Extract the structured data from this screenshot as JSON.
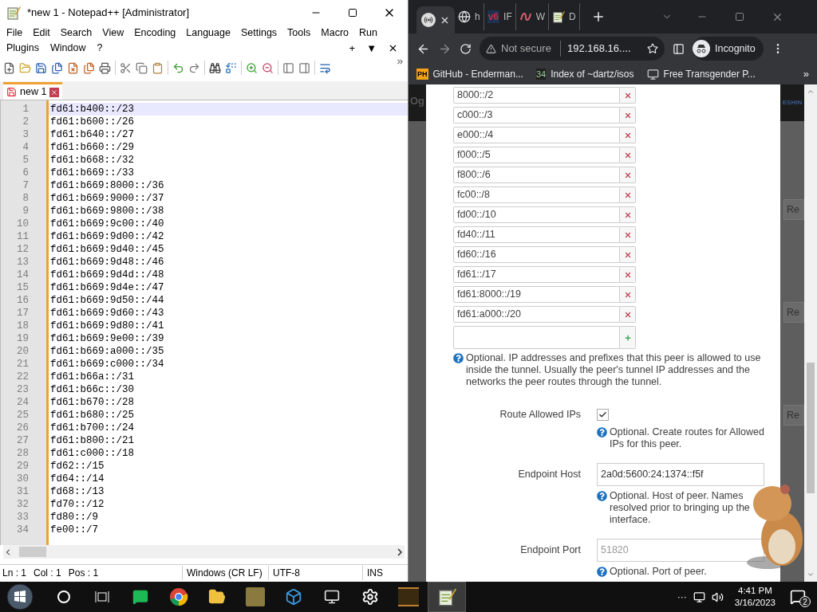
{
  "notepad": {
    "title": "*new 1 - Notepad++ [Administrator]",
    "menu_row1": [
      "File",
      "Edit",
      "Search",
      "View",
      "Encoding",
      "Language",
      "Settings",
      "Tools",
      "Macro",
      "Run"
    ],
    "menu_row2": [
      "Plugins",
      "Window",
      "?"
    ],
    "menu_controls": [
      "+",
      "▼"
    ],
    "tabs": [
      {
        "label": "new 1",
        "selected": true
      }
    ],
    "lines": [
      {
        "number": "1",
        "text": "fd61:b400::/23",
        "current": true
      },
      {
        "number": "2",
        "text": "fd61:b600::/26",
        "current": false
      },
      {
        "number": "3",
        "text": "fd61:b640::/27",
        "current": false
      },
      {
        "number": "4",
        "text": "fd61:b660::/29",
        "current": false
      },
      {
        "number": "5",
        "text": "fd61:b668::/32",
        "current": false
      },
      {
        "number": "6",
        "text": "fd61:b669::/33",
        "current": false
      },
      {
        "number": "7",
        "text": "fd61:b669:8000::/36",
        "current": false
      },
      {
        "number": "8",
        "text": "fd61:b669:9000::/37",
        "current": false
      },
      {
        "number": "9",
        "text": "fd61:b669:9800::/38",
        "current": false
      },
      {
        "number": "10",
        "text": "fd61:b669:9c00::/40",
        "current": false
      },
      {
        "number": "11",
        "text": "fd61:b669:9d00::/42",
        "current": false
      },
      {
        "number": "12",
        "text": "fd61:b669:9d40::/45",
        "current": false
      },
      {
        "number": "13",
        "text": "fd61:b669:9d48::/46",
        "current": false
      },
      {
        "number": "14",
        "text": "fd61:b669:9d4d::/48",
        "current": false
      },
      {
        "number": "15",
        "text": "fd61:b669:9d4e::/47",
        "current": false
      },
      {
        "number": "16",
        "text": "fd61:b669:9d50::/44",
        "current": false
      },
      {
        "number": "17",
        "text": "fd61:b669:9d60::/43",
        "current": false
      },
      {
        "number": "18",
        "text": "fd61:b669:9d80::/41",
        "current": false
      },
      {
        "number": "19",
        "text": "fd61:b669:9e00::/39",
        "current": false
      },
      {
        "number": "20",
        "text": "fd61:b669:a000::/35",
        "current": false
      },
      {
        "number": "21",
        "text": "fd61:b669:c000::/34",
        "current": false
      },
      {
        "number": "22",
        "text": "fd61:b66a::/31",
        "current": false
      },
      {
        "number": "23",
        "text": "fd61:b66c::/30",
        "current": false
      },
      {
        "number": "24",
        "text": "fd61:b670::/28",
        "current": false
      },
      {
        "number": "25",
        "text": "fd61:b680::/25",
        "current": false
      },
      {
        "number": "26",
        "text": "fd61:b700::/24",
        "current": false
      },
      {
        "number": "27",
        "text": "fd61:b800::/21",
        "current": false
      },
      {
        "number": "28",
        "text": "fd61:c000::/18",
        "current": false
      },
      {
        "number": "29",
        "text": "fd62::/15",
        "current": false
      },
      {
        "number": "30",
        "text": "fd64::/14",
        "current": false
      },
      {
        "number": "31",
        "text": "fd68::/13",
        "current": false
      },
      {
        "number": "32",
        "text": "fd70::/12",
        "current": false
      },
      {
        "number": "33",
        "text": "fd80::/9",
        "current": false
      },
      {
        "number": "34",
        "text": "fe00::/7",
        "current": false
      }
    ],
    "status_bar": {
      "positions": [
        "Ln : 1",
        "Col : 1",
        "Pos : 1"
      ],
      "eol": "Windows (CR LF)",
      "encoding": "UTF-8",
      "mode": "INS"
    }
  },
  "browser": {
    "tabs": [
      {
        "kind": "radio",
        "selected": true
      },
      {
        "kind": "globe",
        "label": "h",
        "selected": false
      },
      {
        "kind": "v6",
        "badge": "v6",
        "label": "IF",
        "selected": false
      },
      {
        "kind": "squiggle",
        "label": "W",
        "selected": false
      },
      {
        "kind": "notepad",
        "label": "D",
        "selected": false
      }
    ],
    "security": "Not secure",
    "url": "192.168.16....",
    "profile": "Incognito",
    "bookmarks": [
      {
        "kind": "ph",
        "badge": "PH",
        "label": "GitHub - Enderman..."
      },
      {
        "kind": "number",
        "badge": "34",
        "label": "Index of ~dartz/isos"
      },
      {
        "kind": "computer",
        "label": "Free Transgender P..."
      }
    ],
    "bookmarks_more": "»",
    "background": {
      "header_text": "Og",
      "brand_text": "ESHIN",
      "buttons": [
        "Re",
        "Re",
        "Re"
      ]
    },
    "allowed_ips": [
      "8000::/2",
      "c000::/3",
      "e000::/4",
      "f000::/5",
      "f800::/6",
      "fc00::/8",
      "fd00::/10",
      "fd40::/11",
      "fd60::/16",
      "fd61::/17",
      "fd61:8000::/19",
      "fd61:a000::/20"
    ],
    "allowed_ips_help": "Optional. IP addresses and prefixes that this peer is allowed to use inside the tunnel. Usually the peer's tunnel IP addresses and the networks the peer routes through the tunnel.",
    "fields": [
      {
        "kind": "checkbox",
        "label": "Route Allowed IPs",
        "checked": true,
        "help": [
          "Optional. Create routes for Allowed",
          "IPs for this peer."
        ]
      },
      {
        "kind": "text",
        "label": "Endpoint Host",
        "value": "2a0d:5600:24:1374::f5f",
        "help": [
          "Optional. Host of peer. Names",
          "resolved prior to bringing up the",
          "interface."
        ]
      },
      {
        "kind": "text",
        "label": "Endpoint Port",
        "placeholder": "51820",
        "help": [
          "Optional. Port of peer."
        ]
      }
    ]
  },
  "taskbar": {
    "apps": [
      {
        "kind": "search",
        "active": false
      },
      {
        "kind": "taskview",
        "active": false
      },
      {
        "kind": "chat",
        "active": false
      },
      {
        "kind": "chrome",
        "active": false
      },
      {
        "kind": "folder",
        "active": false
      },
      {
        "kind": "game",
        "active": false
      },
      {
        "kind": "cube",
        "active": false
      },
      {
        "kind": "computer",
        "active": false
      },
      {
        "kind": "gear",
        "active": false
      },
      {
        "kind": "ladder",
        "active": false
      },
      {
        "kind": "notepad",
        "active": true
      }
    ],
    "overflow": "···",
    "time": "4:41 PM",
    "date": "3/16/2023",
    "notifications": "2"
  }
}
